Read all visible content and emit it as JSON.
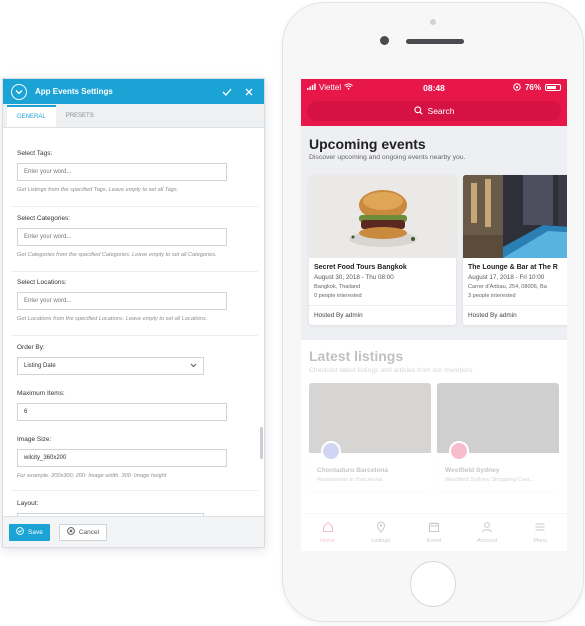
{
  "settings_panel": {
    "title": "App Events Settings",
    "tabs": [
      {
        "label": "GENERAL",
        "active": true
      },
      {
        "label": "PRESETS",
        "active": false
      }
    ],
    "fields": {
      "tags": {
        "label": "Select Tags:",
        "placeholder": "Enter your word...",
        "help": "Get Listings from the specified Tags. Leave empty to set all Tags."
      },
      "categories": {
        "label": "Select Categories:",
        "placeholder": "Enter your word...",
        "help": "Get Categories from the specified Categories. Leave empty to set all Categories."
      },
      "locations": {
        "label": "Select Locations:",
        "placeholder": "Enter your word...",
        "help": "Get Locations from the specified Locations. Leave empty to set all Locations."
      },
      "order_by": {
        "label": "Order By:",
        "value": "Listing Date"
      },
      "max_items": {
        "label": "Maximum Items:",
        "value": "6"
      },
      "image_size": {
        "label": "Image Size:",
        "value": "wilcity_360x200",
        "help": "For example: 200x300, 200: Image width. 300: Image height"
      },
      "layout": {
        "label": "Layout:"
      }
    },
    "footer": {
      "save_label": "Save",
      "cancel_label": "Cancel"
    },
    "accent_color": "#1ba3d6"
  },
  "phone": {
    "status": {
      "carrier": "Viettel",
      "time": "08:48",
      "battery": "76%",
      "battery_level": 0.76
    },
    "search_label": "Search",
    "upcoming": {
      "title": "Upcoming events",
      "subtitle": "Discover upcoming and ongoing events nearby you.",
      "cards": [
        {
          "title": "Secret Food Tours Bangkok",
          "date": "August 30, 2018 - Thu 08:00",
          "location": "Bangkok, Thailand",
          "interested": "0 people interested",
          "host": "Hosted By admin"
        },
        {
          "title": "The Lounge & Bar at The R",
          "date": "August 17, 2018 - Fri 10:00",
          "location": "Carrer d'Aribau, 254, 08006, Ba",
          "interested": "3 people interested",
          "host": "Hosted By admin"
        }
      ]
    },
    "latest": {
      "title": "Latest listings",
      "subtitle": "Checkout latest listings and articles from our members",
      "cards": [
        {
          "title": "Chontaduro Barcelona",
          "subtitle": "Restaurants in Barcelona",
          "badge_color": "#5b6bd6"
        },
        {
          "title": "Westfield Sydney",
          "subtitle": "Westfield Sydney Shopping Cent...",
          "badge_color": "#e8174a"
        }
      ]
    },
    "tabbar": [
      {
        "label": "Home",
        "icon": "home-icon",
        "active": true
      },
      {
        "label": "Listings",
        "icon": "map-pin-icon",
        "active": false
      },
      {
        "label": "Event",
        "icon": "calendar-icon",
        "active": false
      },
      {
        "label": "Account",
        "icon": "user-icon",
        "active": false
      },
      {
        "label": "Menu",
        "icon": "menu-icon",
        "active": false
      }
    ],
    "brand_color": "#e8174a"
  }
}
